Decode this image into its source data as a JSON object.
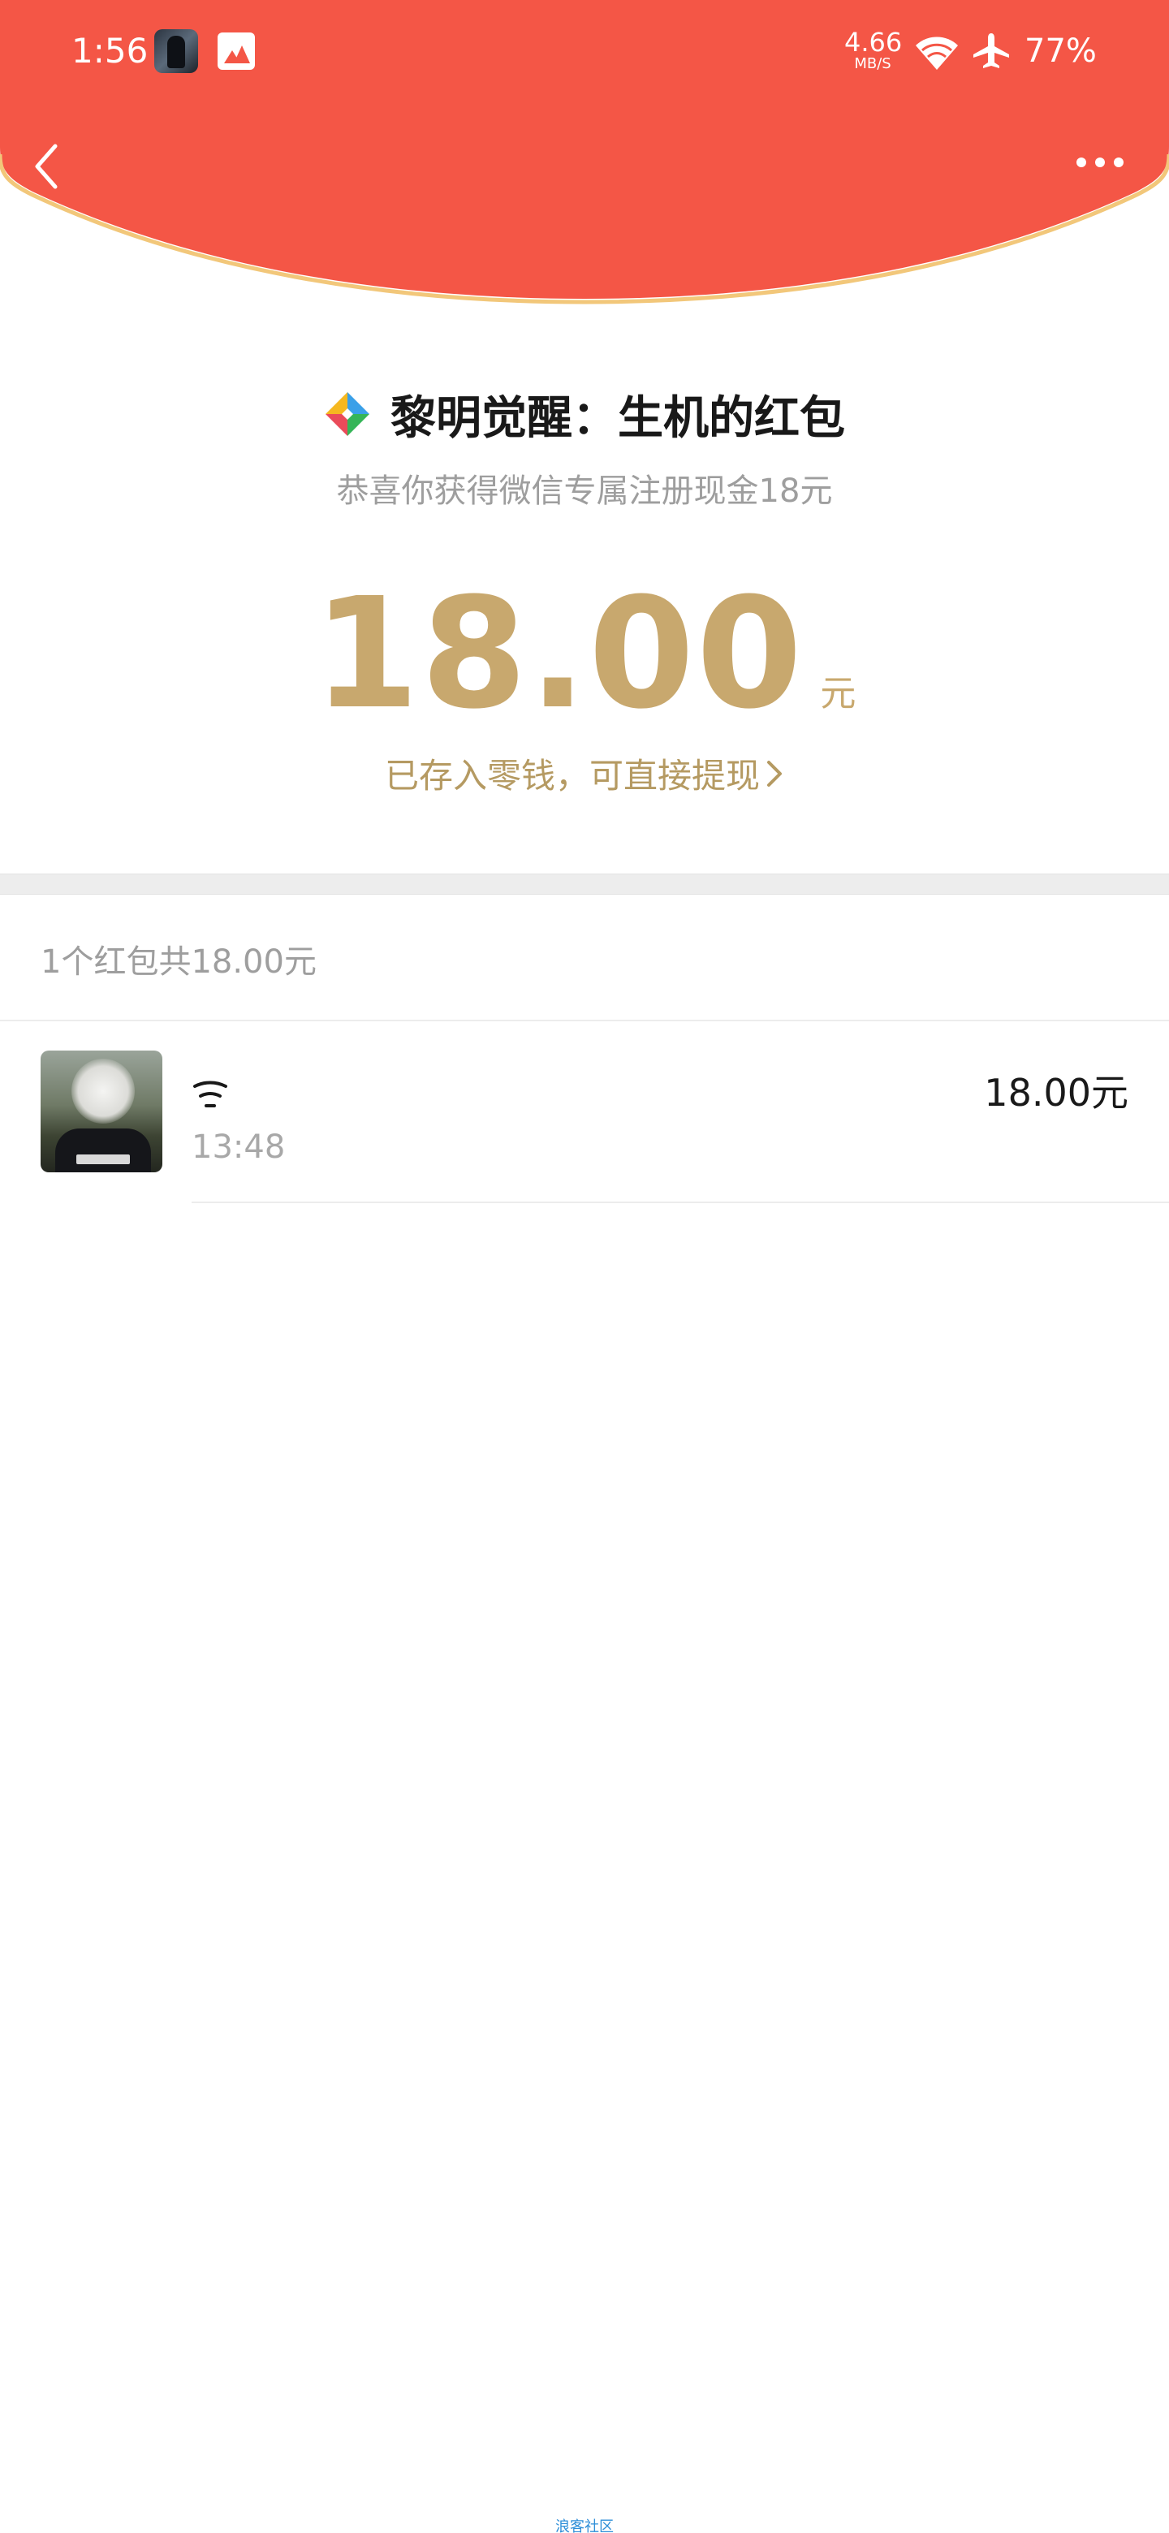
{
  "status_bar": {
    "time": "1:56",
    "net_speed_value": "4.66",
    "net_speed_unit": "MB/S",
    "battery": "77%",
    "icons": [
      "app-thumbnail-icon",
      "gallery-icon",
      "wifi-icon",
      "airplane-mode-icon"
    ]
  },
  "colors": {
    "header_red": "#f45646",
    "header_border": "#f2c77a",
    "gold": "#c8a86e",
    "gray_text": "#9e9e9e"
  },
  "nav": {
    "back_icon": "chevron-left-icon",
    "more_icon": "more-dots-icon"
  },
  "packet": {
    "title": "黎明觉醒：生机的红包",
    "subtitle": "恭喜你获得微信专属注册现金18元",
    "amount": "18.00",
    "unit": "元",
    "stored_link": "已存入零钱，可直接提现"
  },
  "summary": "1个红包共18.00元",
  "records": [
    {
      "time": "13:48",
      "amount": "18.00元"
    }
  ],
  "footer": "浪客社区"
}
